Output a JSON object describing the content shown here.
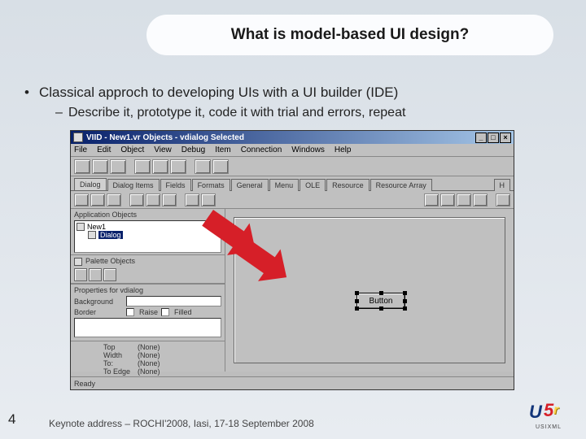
{
  "slide": {
    "title": "What is model-based UI design?",
    "bullet_main": "Classical approch to developing UIs with a UI builder (IDE)",
    "bullet_sub": "Describe it, prototype it, code it with trial and errors, repeat",
    "page_number": "4",
    "footer": "Keynote address – ROCHI'2008, Iasi, 17-18 September 2008",
    "logo_text": "USIXML"
  },
  "ide": {
    "title": "VIID - New1.vr Objects - vdialog Selected",
    "window_buttons": {
      "min": "_",
      "max": "□",
      "close": "×"
    },
    "menus": [
      "File",
      "Edit",
      "Object",
      "View",
      "Debug",
      "Item",
      "Connection",
      "Windows",
      "Help"
    ],
    "tabs": [
      "Dialog",
      "Dialog Items",
      "Fields",
      "Formats",
      "General",
      "Menu",
      "OLE",
      "Resource",
      "Resource Array"
    ],
    "tabs_right": "H",
    "left": {
      "objects_label": "Application Objects",
      "tree_root": "New1",
      "tree_selected": "Dialog",
      "palette_label": "Palette Objects",
      "props_title": "Properties for vdialog",
      "prop_background": "Background",
      "prop_border": "Border",
      "prop_raise": "Raise",
      "prop_filled": "Filled",
      "coords": [
        {
          "label": "Top",
          "value": "(None)"
        },
        {
          "label": "Width",
          "value": "(None)"
        },
        {
          "label": "To:",
          "value": "(None)"
        },
        {
          "label": "To Edge",
          "value": "(None)"
        }
      ]
    },
    "canvas": {
      "placed_control": "Button"
    },
    "status": "Ready"
  }
}
